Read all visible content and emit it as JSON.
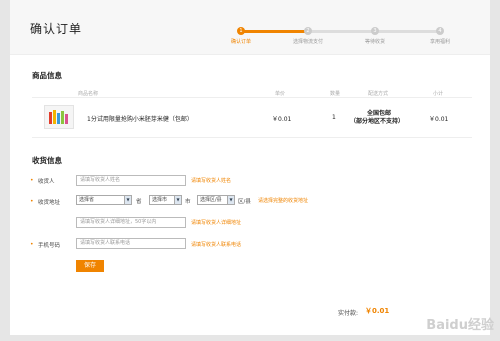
{
  "header": {
    "title": "确认订单"
  },
  "steps": [
    {
      "num": "1",
      "label": "确认订单"
    },
    {
      "num": "2",
      "label": "选择物流支付"
    },
    {
      "num": "3",
      "label": "等待收货"
    },
    {
      "num": "4",
      "label": "享用福利"
    }
  ],
  "goods": {
    "section_title": "商品信息",
    "columns": {
      "name": "商品名称",
      "price": "单价",
      "qty": "数量",
      "shipping": "配送方式",
      "subtotal": "小计"
    },
    "item": {
      "name": "1分试用限量抢购小米胚芽米健（包邮）",
      "price": "￥0.01",
      "qty": "1",
      "shipping_line1": "全国包邮",
      "shipping_line2": "（部分地区不支持）",
      "subtotal": "￥0.01"
    }
  },
  "address": {
    "section_title": "收货信息",
    "receiver_label": "收货人",
    "receiver_placeholder": "请填写收货人姓名",
    "receiver_hint": "请填写收货人姓名",
    "addr_label": "收货地址",
    "province": "选择省",
    "province_suffix": "省",
    "city": "选择市",
    "city_suffix": "市",
    "district": "选择区/县",
    "district_suffix": "区/县",
    "addr_hint": "请选择完整的收货地址",
    "detail_placeholder": "请填写收货人详细地址，50字以内",
    "detail_hint": "请填写收货人详细地址",
    "phone_label": "手机号码",
    "phone_placeholder": "请填写收货人联系电话",
    "phone_hint": "请填写收货人联系电话",
    "save_label": "保存"
  },
  "summary": {
    "label": "实付款:",
    "value": "￥0.01"
  },
  "watermark": "Baidu经验",
  "colors": {
    "accent": "#f08400",
    "page_bg": "#e6e6e6"
  }
}
